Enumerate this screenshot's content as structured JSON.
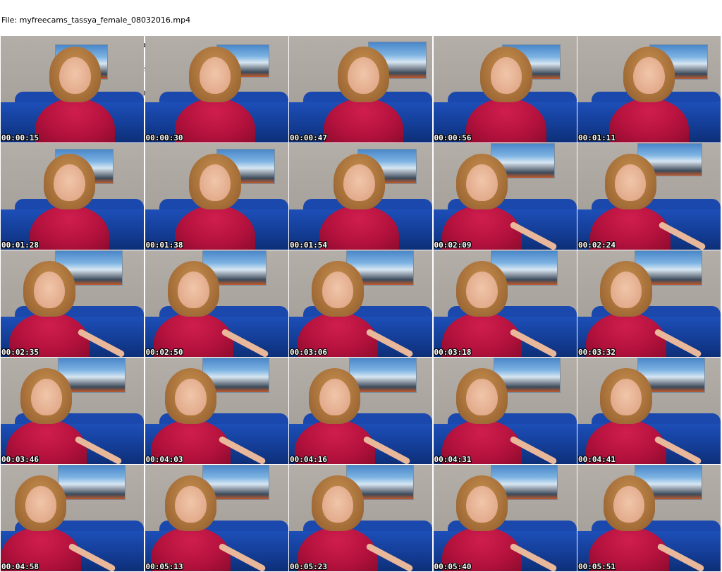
{
  "header": {
    "file_line": "File: myfreecams_tassya_female_08032016.mp4",
    "size_line": "Size: 6684736 bytes (6.38 MiB), duration: 00:06:11, avg.bitrate: 144 kb/s",
    "audio_line": "Audio: mp3, 16000 Hz, mono, 24 kb/s (und)",
    "video_line": "Video: h264, yuv420p, 320x240, 1000.00 fps(r) (und)"
  },
  "colors": {
    "background": "#ffffff",
    "shirt": "#b5123e",
    "sofa": "#133c94",
    "wall": "#aaa49e",
    "hair": "#a8713a",
    "skin": "#e2ab8c"
  },
  "thumbnails": [
    {
      "timestamp": "00:00:15"
    },
    {
      "timestamp": "00:00:30"
    },
    {
      "timestamp": "00:00:47"
    },
    {
      "timestamp": "00:00:56"
    },
    {
      "timestamp": "00:01:11"
    },
    {
      "timestamp": "00:01:28"
    },
    {
      "timestamp": "00:01:38"
    },
    {
      "timestamp": "00:01:54"
    },
    {
      "timestamp": "00:02:09"
    },
    {
      "timestamp": "00:02:24"
    },
    {
      "timestamp": "00:02:35"
    },
    {
      "timestamp": "00:02:50"
    },
    {
      "timestamp": "00:03:06"
    },
    {
      "timestamp": "00:03:18"
    },
    {
      "timestamp": "00:03:32"
    },
    {
      "timestamp": "00:03:46"
    },
    {
      "timestamp": "00:04:03"
    },
    {
      "timestamp": "00:04:16"
    },
    {
      "timestamp": "00:04:31"
    },
    {
      "timestamp": "00:04:41"
    },
    {
      "timestamp": "00:04:58"
    },
    {
      "timestamp": "00:05:13"
    },
    {
      "timestamp": "00:05:23"
    },
    {
      "timestamp": "00:05:40"
    },
    {
      "timestamp": "00:05:51"
    }
  ]
}
